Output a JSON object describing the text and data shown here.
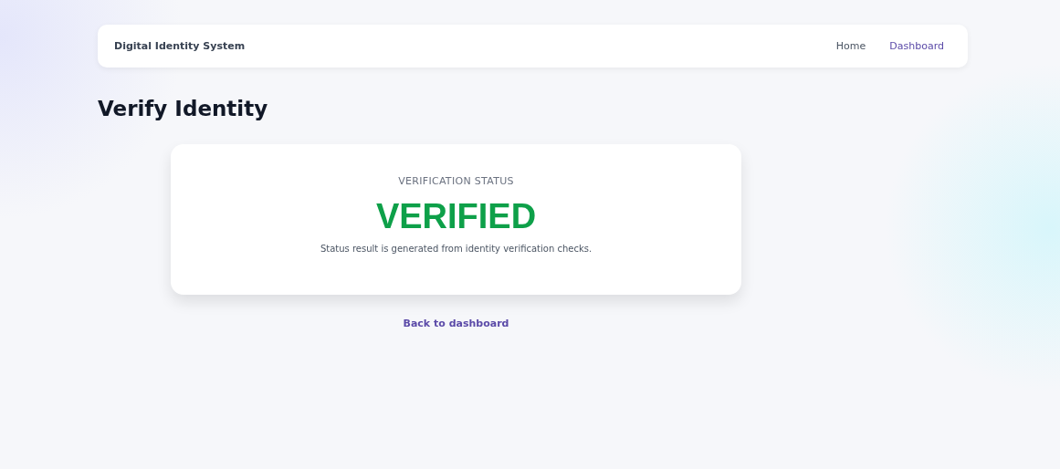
{
  "navbar": {
    "brand": "Digital Identity System",
    "links": [
      {
        "label": "Home",
        "selected": false
      },
      {
        "label": "Dashboard",
        "selected": true
      }
    ]
  },
  "page_title": "Verify Identity",
  "status_card": {
    "label": "VERIFICATION STATUS",
    "value": "VERIFIED",
    "kind": "verified",
    "note": "Status result is generated from identity verification checks."
  },
  "back_link": "Back to dashboard"
}
